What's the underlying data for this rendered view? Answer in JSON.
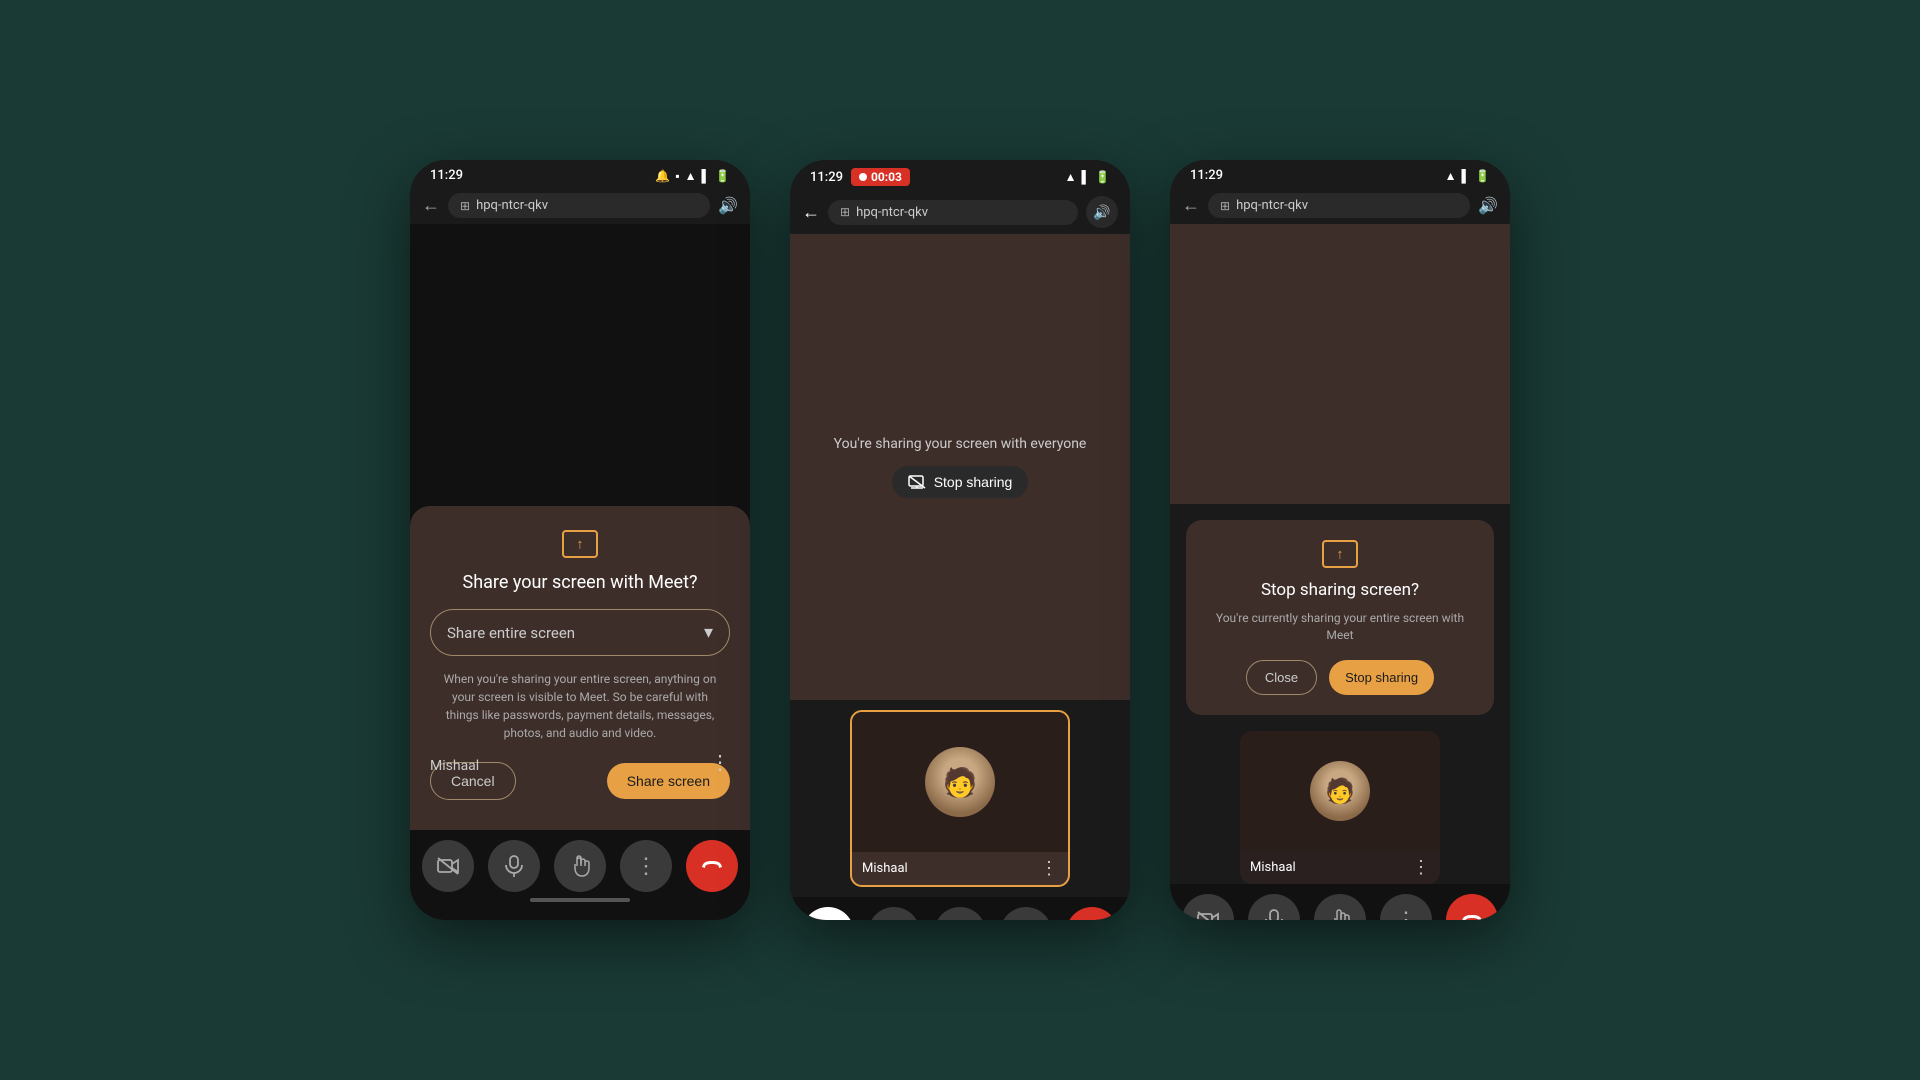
{
  "background_color": "#1a3a35",
  "phone1": {
    "status_bar": {
      "time": "11:29",
      "icons": [
        "notification",
        "sim",
        "wifi",
        "signal",
        "battery"
      ]
    },
    "address_bar": {
      "url": "hpq-ntcr-qkv"
    },
    "dialog": {
      "title": "Share your screen with Meet?",
      "dropdown_value": "Share entire screen",
      "warning_text": "When you're sharing your entire screen, anything on your screen is visible to Meet. So be careful with things like passwords, payment details, messages, photos, and audio and video.",
      "cancel_label": "Cancel",
      "share_label": "Share screen"
    },
    "user_name": "Mishaal"
  },
  "phone2": {
    "status_bar": {
      "time": "11:29",
      "recording": "00:03"
    },
    "address_bar": {
      "url": "hpq-ntcr-qkv"
    },
    "sharing_text": "You're sharing your screen with everyone",
    "stop_sharing_label": "Stop sharing",
    "participant": {
      "name": "Mishaal"
    }
  },
  "phone3": {
    "status_bar": {
      "time": "11:29"
    },
    "address_bar": {
      "url": "hpq-ntcr-qkv"
    },
    "dialog": {
      "title": "Stop sharing screen?",
      "description": "You're currently sharing your entire screen with Meet",
      "close_label": "Close",
      "stop_label": "Stop sharing"
    },
    "participant": {
      "name": "Mishaal"
    }
  }
}
